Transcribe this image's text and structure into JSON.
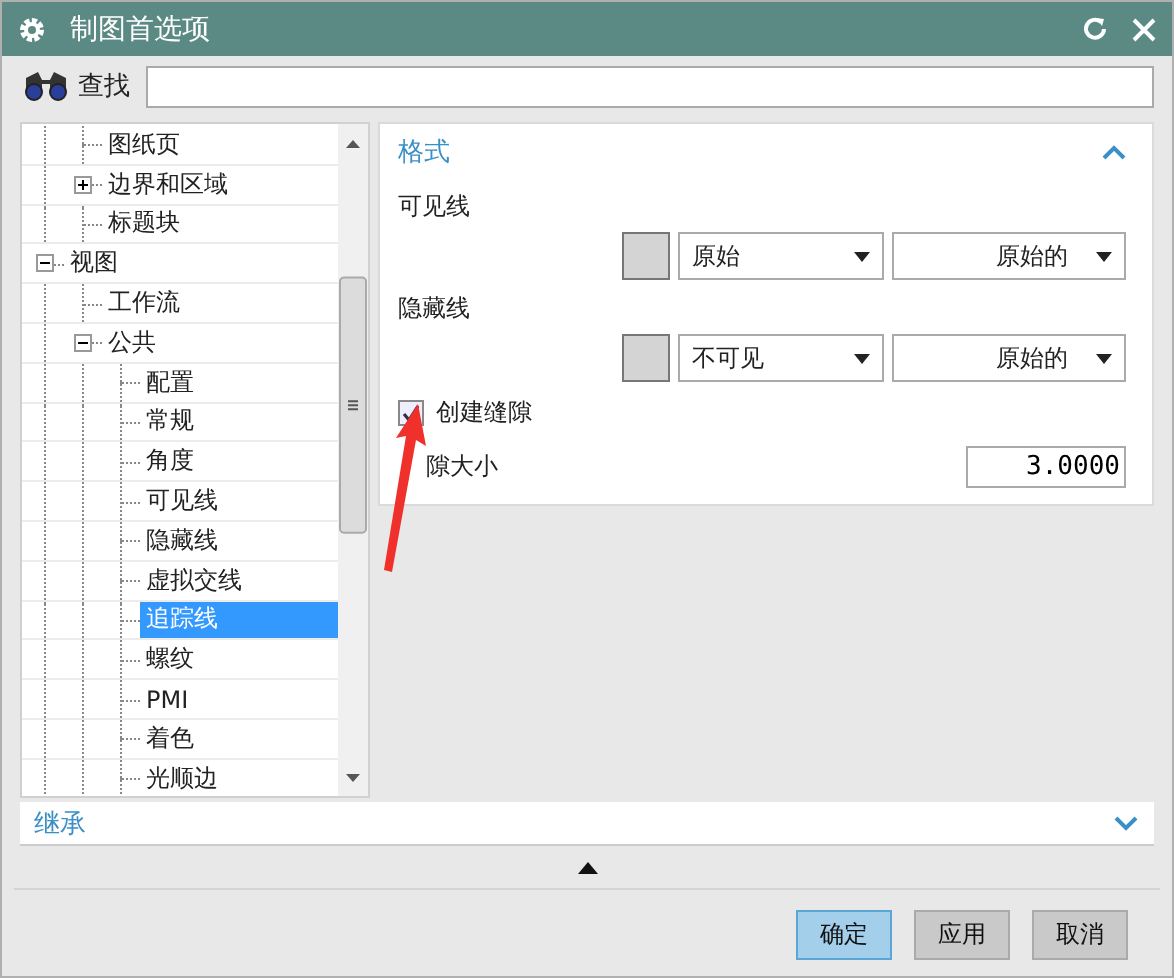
{
  "window": {
    "title": "制图首选项"
  },
  "search": {
    "label": "查找"
  },
  "tree": {
    "items": [
      {
        "children": [
          {
            "label": "图纸页",
            "selected": false
          },
          {
            "label": "边界和区域",
            "selected": false,
            "expanded": false
          },
          {
            "label": "标题块",
            "selected": false
          }
        ]
      },
      {
        "label": "视图",
        "selected": false,
        "expanded": true,
        "children": [
          {
            "label": "工作流",
            "selected": false
          },
          {
            "label": "公共",
            "selected": false,
            "expanded": true,
            "children": [
              {
                "label": "配置",
                "selected": false
              },
              {
                "label": "常规",
                "selected": false
              },
              {
                "label": "角度",
                "selected": false
              },
              {
                "label": "可见线",
                "selected": false
              },
              {
                "label": "隐藏线",
                "selected": false
              },
              {
                "label": "虚拟交线",
                "selected": false
              },
              {
                "label": "追踪线",
                "selected": true
              },
              {
                "label": "螺纹",
                "selected": false
              },
              {
                "label": "PMI",
                "selected": false
              },
              {
                "label": "着色",
                "selected": false
              },
              {
                "label": "光顺边",
                "selected": false
              }
            ]
          }
        ]
      }
    ]
  },
  "format_section": {
    "title": "格式",
    "expanded": true,
    "line_settings": [
      {
        "label": "可见线",
        "font": "原始",
        "width": "原始的"
      },
      {
        "label": "隐藏线",
        "font": "不可见",
        "width": "原始的"
      }
    ],
    "create_gap": {
      "label": "创建缝隙",
      "checked": true
    },
    "gap_size": {
      "label": "隙大小",
      "value": "3.0000"
    }
  },
  "inherit_section": {
    "title": "继承",
    "expanded": false
  },
  "buttons": [
    {
      "label": "确定",
      "kind": "primary"
    },
    {
      "label": "应用",
      "kind": "normal"
    },
    {
      "label": "取消",
      "kind": "normal"
    }
  ]
}
